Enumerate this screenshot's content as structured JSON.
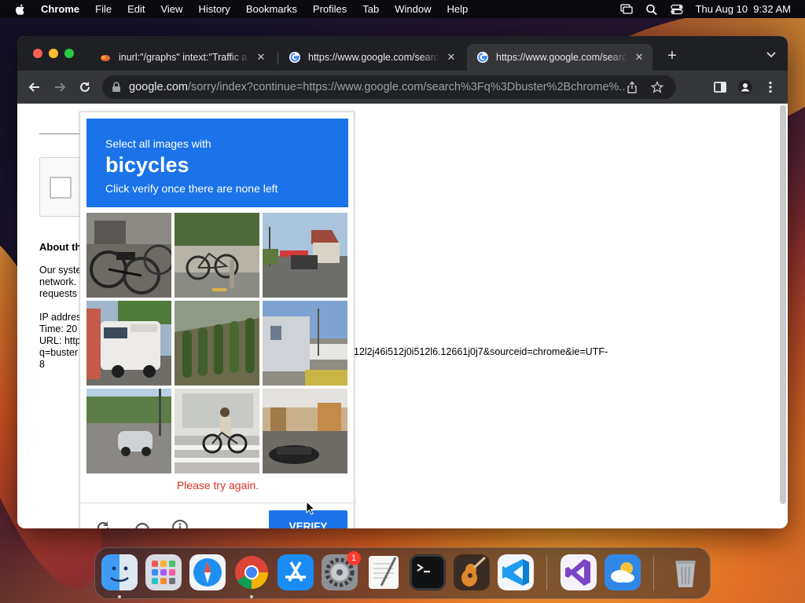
{
  "menubar": {
    "app_name": "Chrome",
    "items": [
      "File",
      "Edit",
      "View",
      "History",
      "Bookmarks",
      "Profiles",
      "Tab",
      "Window",
      "Help"
    ],
    "clock": "Thu Aug 10  9:32 AM"
  },
  "tabs": [
    {
      "title": "inurl:\"/graphs\" intext:\"Traffic a",
      "favicon": "firefox-fox-icon",
      "active": false
    },
    {
      "title": "https://www.google.com/searc",
      "favicon": "google-icon",
      "active": false
    },
    {
      "title": "https://www.google.com/searc",
      "favicon": "google-icon",
      "active": true
    }
  ],
  "address_bar": {
    "host": "google.com",
    "path": "/sorry/index?continue=https://www.google.com/search%3Fq%3Dbuster%2Bchrome%..."
  },
  "page": {
    "about_heading": "About th",
    "paragraph_lines": [
      "Our syste",
      "network.",
      "requests"
    ],
    "ip_line": "IP addres",
    "time_line": "Time: 20",
    "url_line": "URL: http",
    "url_line2": "q=buster",
    "url_line3": "8",
    "url_continuation": "12l2j46i512j0i512l6.12661j0j7&sourceid=chrome&ie=UTF-"
  },
  "captcha": {
    "instruction_line1": "Select all images with",
    "keyword": "bicycles",
    "instruction_line3": "Click verify once there are none left",
    "error_message": "Please try again.",
    "verify_label": "VERIFY",
    "tiles": [
      "parked-bicycles",
      "bicycle-by-wall",
      "street-market",
      "camper-van",
      "hedge-wall",
      "building-street",
      "street-car",
      "cyclist-crosswalk",
      "car-on-street"
    ]
  },
  "dock": {
    "apps": [
      "Finder",
      "Launchpad",
      "Safari",
      "Chrome",
      "App Store",
      "System Settings",
      "TextEdit",
      "Terminal",
      "GarageBand",
      "Visual Studio Code",
      "Visual Studio",
      "Weather",
      "Trash"
    ],
    "settings_badge": "1"
  },
  "colors": {
    "captcha_blue": "#1a73e8",
    "error_red": "#d93025",
    "tabstrip": "#1f2023",
    "toolbar": "#35363a"
  }
}
